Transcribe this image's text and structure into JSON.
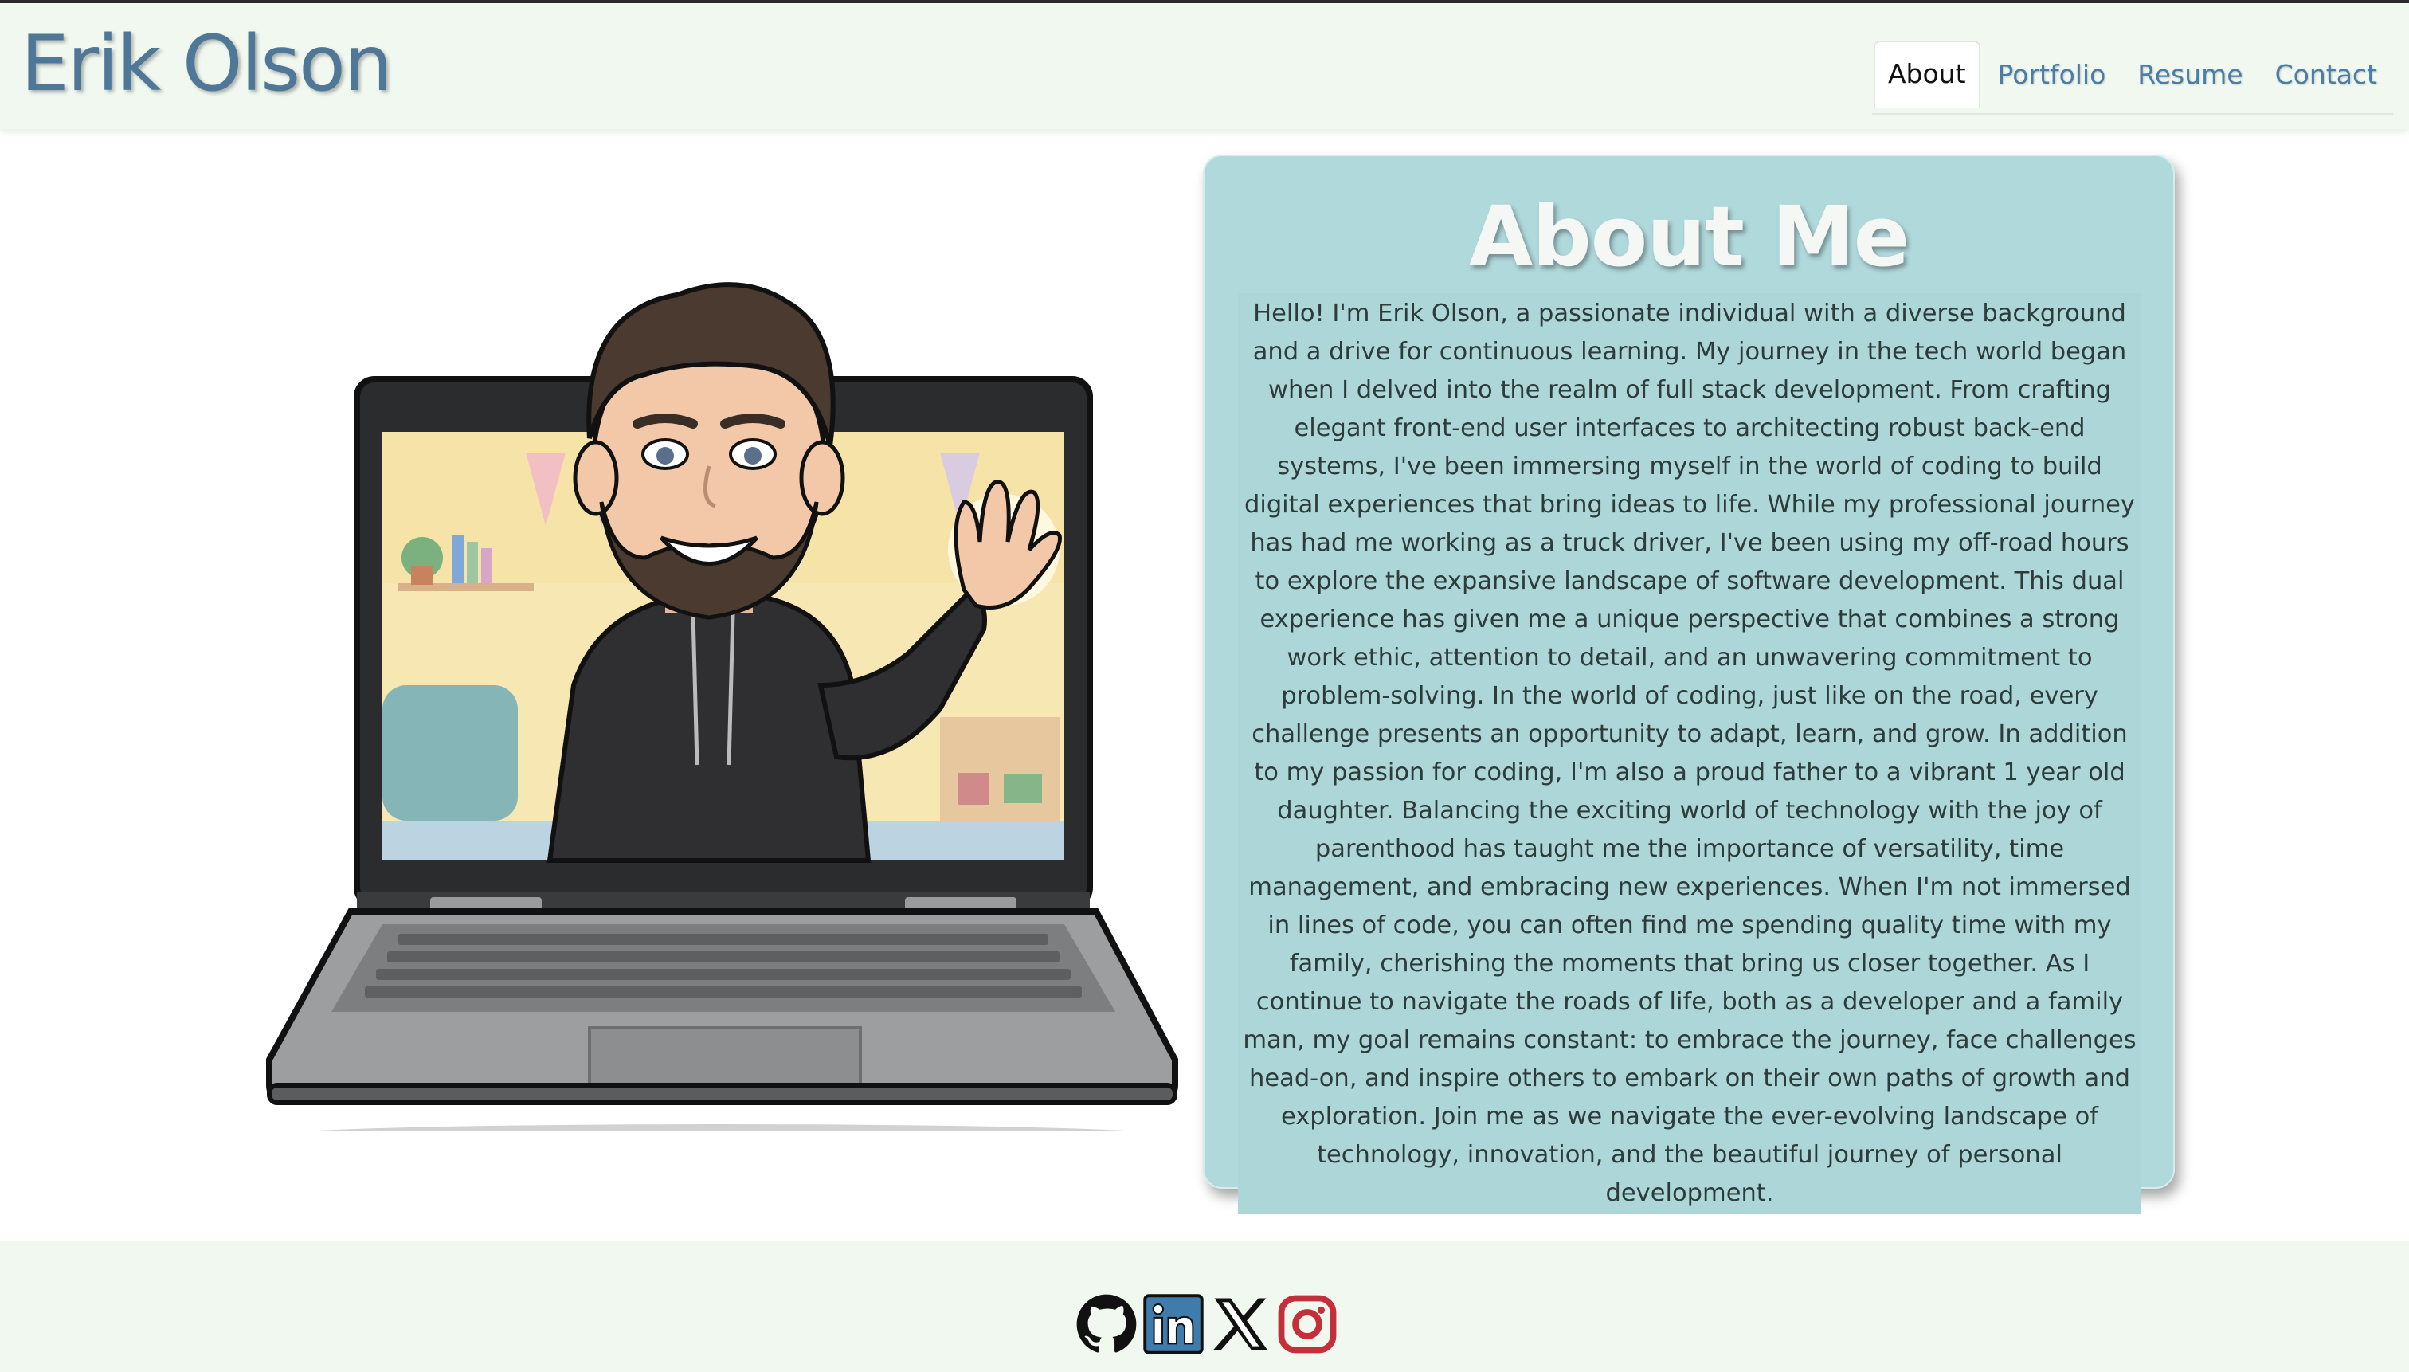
{
  "header": {
    "site_title": "Erik Olson",
    "nav": [
      {
        "label": "About",
        "active": true
      },
      {
        "label": "Portfolio",
        "active": false
      },
      {
        "label": "Resume",
        "active": false
      },
      {
        "label": "Contact",
        "active": false
      }
    ]
  },
  "hero": {
    "image_name": "bitmoji-waving-from-laptop"
  },
  "about": {
    "title": "About Me",
    "body": "Hello! I'm Erik Olson, a passionate individual with a diverse background and a drive for continuous learning. My journey in the tech world began when I delved into the realm of full stack development. From crafting elegant front-end user interfaces to architecting robust back-end systems, I've been immersing myself in the world of coding to build digital experiences that bring ideas to life. While my professional journey has had me working as a truck driver, I've been using my off-road hours to explore the expansive landscape of software development. This dual experience has given me a unique perspective that combines a strong work ethic, attention to detail, and an unwavering commitment to problem-solving. In the world of coding, just like on the road, every challenge presents an opportunity to adapt, learn, and grow. In addition to my passion for coding, I'm also a proud father to a vibrant 1 year old daughter. Balancing the exciting world of technology with the joy of parenthood has taught me the importance of versatility, time management, and embracing new experiences. When I'm not immersed in lines of code, you can often find me spending quality time with my family, cherishing the moments that bring us closer together. As I continue to navigate the roads of life, both as a developer and a family man, my goal remains constant: to embrace the journey, face challenges head-on, and inspire others to embark on their own paths of growth and exploration. Join me as we navigate the ever-evolving landscape of technology, innovation, and the beautiful journey of personal development."
  },
  "footer": {
    "socials": [
      "github-icon",
      "linkedin-icon",
      "x-icon",
      "instagram-icon"
    ]
  },
  "colors": {
    "header_bg": "#f1f8ef",
    "title": "#4f7898",
    "nav_link": "#4a7ea8",
    "card_bg": "#b0d9dc",
    "instagram": "#c4303a",
    "linkedin": "#3f7cab"
  }
}
